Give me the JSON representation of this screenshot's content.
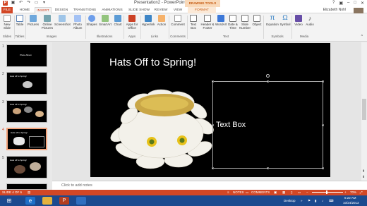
{
  "window": {
    "title": "Presentation2 - PowerPoint",
    "contextual_tab_group": "DRAWING TOOLS",
    "user": "Elizabeth Nohl"
  },
  "tabs": [
    "FILE",
    "HOME",
    "INSERT",
    "DESIGN",
    "TRANSITIONS",
    "ANIMATIONS",
    "SLIDE SHOW",
    "REVIEW",
    "VIEW",
    "FORMAT"
  ],
  "active_tab": "INSERT",
  "ribbon": {
    "buttons": {
      "new_slide": "New Slide",
      "table": "Table",
      "pictures": "Pictures",
      "online_pictures": "Online Pictures",
      "screenshot": "Screenshot",
      "photo_album": "Photo Album",
      "shapes": "Shapes",
      "smartart": "SmartArt",
      "chart": "Chart",
      "apps_for_office": "Apps for Office",
      "hyperlink": "Hyperlink",
      "action": "Action",
      "comment": "Comment",
      "text_box": "Text Box",
      "header_footer": "Header & Footer",
      "wordart": "WordArt",
      "date_time": "Date & Time",
      "slide_number": "Slide Number",
      "object": "Object",
      "equation": "Equation",
      "symbol": "Symbol",
      "video": "Video",
      "audio": "Audio"
    },
    "groups": {
      "slides": "Slides",
      "tables": "Tables",
      "images": "Images",
      "illustrations": "Illustrations",
      "apps": "Apps",
      "links": "Links",
      "comments": "Comments",
      "text": "Text",
      "symbols": "Symbols",
      "media": "Media"
    }
  },
  "thumbnails": [
    {
      "num": "1",
      "title": "Photo Album"
    },
    {
      "num": "2",
      "title": "Hats off to Spring!"
    },
    {
      "num": "3",
      "title": "Hats off to Spring!"
    },
    {
      "num": "4",
      "title": "Hats off to Spring!"
    },
    {
      "num": "5",
      "title": "Hats off to Spring!"
    }
  ],
  "slide": {
    "title": "Hats Off to Spring!",
    "textbox": "Text Box"
  },
  "notes_placeholder": "Click to add notes",
  "status": {
    "slide_counter": "SLIDE 4 OF 6",
    "notes": "NOTES",
    "comments": "COMMENTS",
    "zoom": "70%"
  },
  "taskbar": {
    "desktop": "Desktop",
    "time": "6:22 AM",
    "date": "10/24/2013"
  },
  "colors": {
    "accent": "#d24726",
    "taskbar": "#1b4a8f"
  }
}
